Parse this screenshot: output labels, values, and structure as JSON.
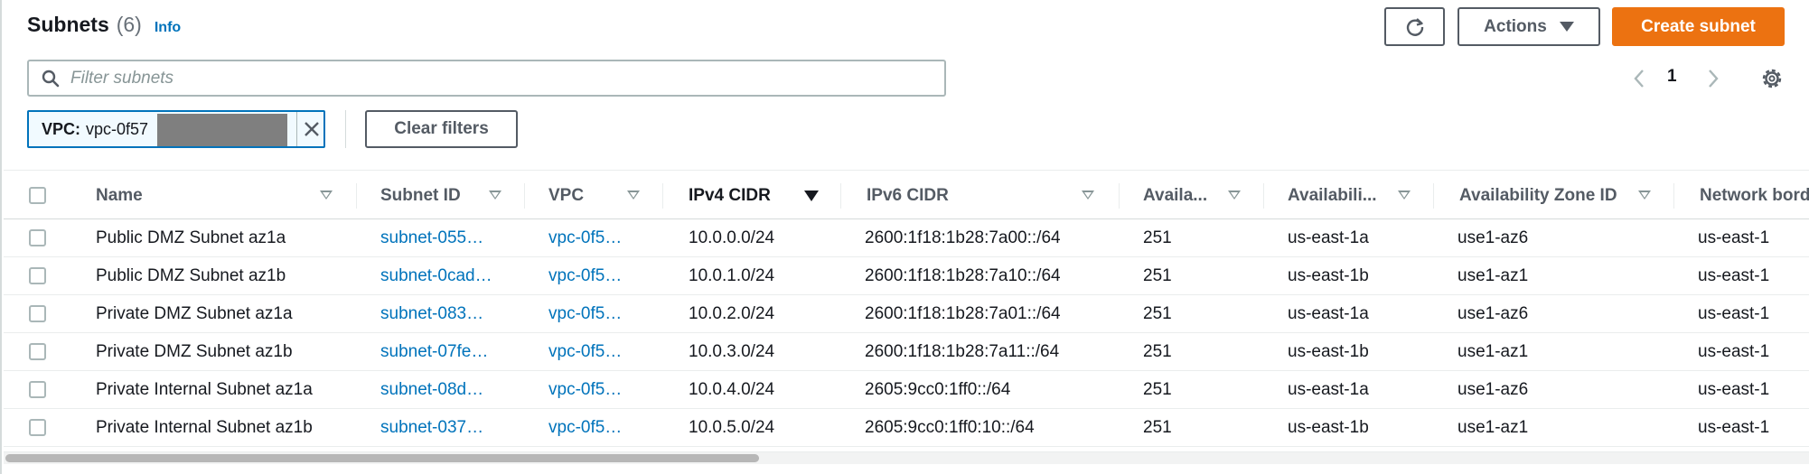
{
  "header": {
    "title": "Subnets",
    "count": "(6)",
    "info_label": "Info",
    "actions_label": "Actions",
    "create_label": "Create subnet"
  },
  "search": {
    "placeholder": "Filter subnets",
    "icon": "search-icon"
  },
  "pagination": {
    "current_page": "1"
  },
  "filter": {
    "token_label": "VPC:",
    "token_value": "vpc-0f57",
    "clear_label": "Clear filters"
  },
  "table": {
    "columns": [
      {
        "label": "Name",
        "sortable": true,
        "sorted": false
      },
      {
        "label": "Subnet ID",
        "sortable": true,
        "sorted": false
      },
      {
        "label": "VPC",
        "sortable": true,
        "sorted": false
      },
      {
        "label": "IPv4 CIDR",
        "sortable": true,
        "sorted": true
      },
      {
        "label": "IPv6 CIDR",
        "sortable": true,
        "sorted": false
      },
      {
        "label": "Availa...",
        "sortable": true,
        "sorted": false
      },
      {
        "label": "Availabili...",
        "sortable": true,
        "sorted": false
      },
      {
        "label": "Availability Zone ID",
        "sortable": true,
        "sorted": false
      },
      {
        "label": "Network bord",
        "sortable": false,
        "sorted": false
      }
    ],
    "rows": [
      {
        "name": "Public DMZ Subnet az1a",
        "subnet_id": "subnet-055…",
        "vpc": "vpc-0f5…",
        "ipv4": "10.0.0.0/24",
        "ipv6": "2600:1f18:1b28:7a00::/64",
        "available_ips": "251",
        "az": "us-east-1a",
        "az_id": "use1-az6",
        "network_border": "us-east-1"
      },
      {
        "name": "Public DMZ Subnet az1b",
        "subnet_id": "subnet-0cad…",
        "vpc": "vpc-0f5…",
        "ipv4": "10.0.1.0/24",
        "ipv6": "2600:1f18:1b28:7a10::/64",
        "available_ips": "251",
        "az": "us-east-1b",
        "az_id": "use1-az1",
        "network_border": "us-east-1"
      },
      {
        "name": "Private DMZ Subnet az1a",
        "subnet_id": "subnet-083…",
        "vpc": "vpc-0f5…",
        "ipv4": "10.0.2.0/24",
        "ipv6": "2600:1f18:1b28:7a01::/64",
        "available_ips": "251",
        "az": "us-east-1a",
        "az_id": "use1-az6",
        "network_border": "us-east-1"
      },
      {
        "name": "Private DMZ Subnet az1b",
        "subnet_id": "subnet-07fe…",
        "vpc": "vpc-0f5…",
        "ipv4": "10.0.3.0/24",
        "ipv6": "2600:1f18:1b28:7a11::/64",
        "available_ips": "251",
        "az": "us-east-1b",
        "az_id": "use1-az1",
        "network_border": "us-east-1"
      },
      {
        "name": "Private Internal Subnet az1a",
        "subnet_id": "subnet-08d…",
        "vpc": "vpc-0f5…",
        "ipv4": "10.0.4.0/24",
        "ipv6": "2605:9cc0:1ff0::/64",
        "available_ips": "251",
        "az": "us-east-1a",
        "az_id": "use1-az6",
        "network_border": "us-east-1"
      },
      {
        "name": "Private Internal Subnet az1b",
        "subnet_id": "subnet-037…",
        "vpc": "vpc-0f5…",
        "ipv4": "10.0.5.0/24",
        "ipv6": "2605:9cc0:1ff0:10::/64",
        "available_ips": "251",
        "az": "us-east-1b",
        "az_id": "use1-az1",
        "network_border": "us-east-1"
      }
    ]
  },
  "colors": {
    "accent": "#0073bb",
    "primary_button": "#ec7211",
    "text": "#16191f",
    "muted": "#545b64"
  }
}
